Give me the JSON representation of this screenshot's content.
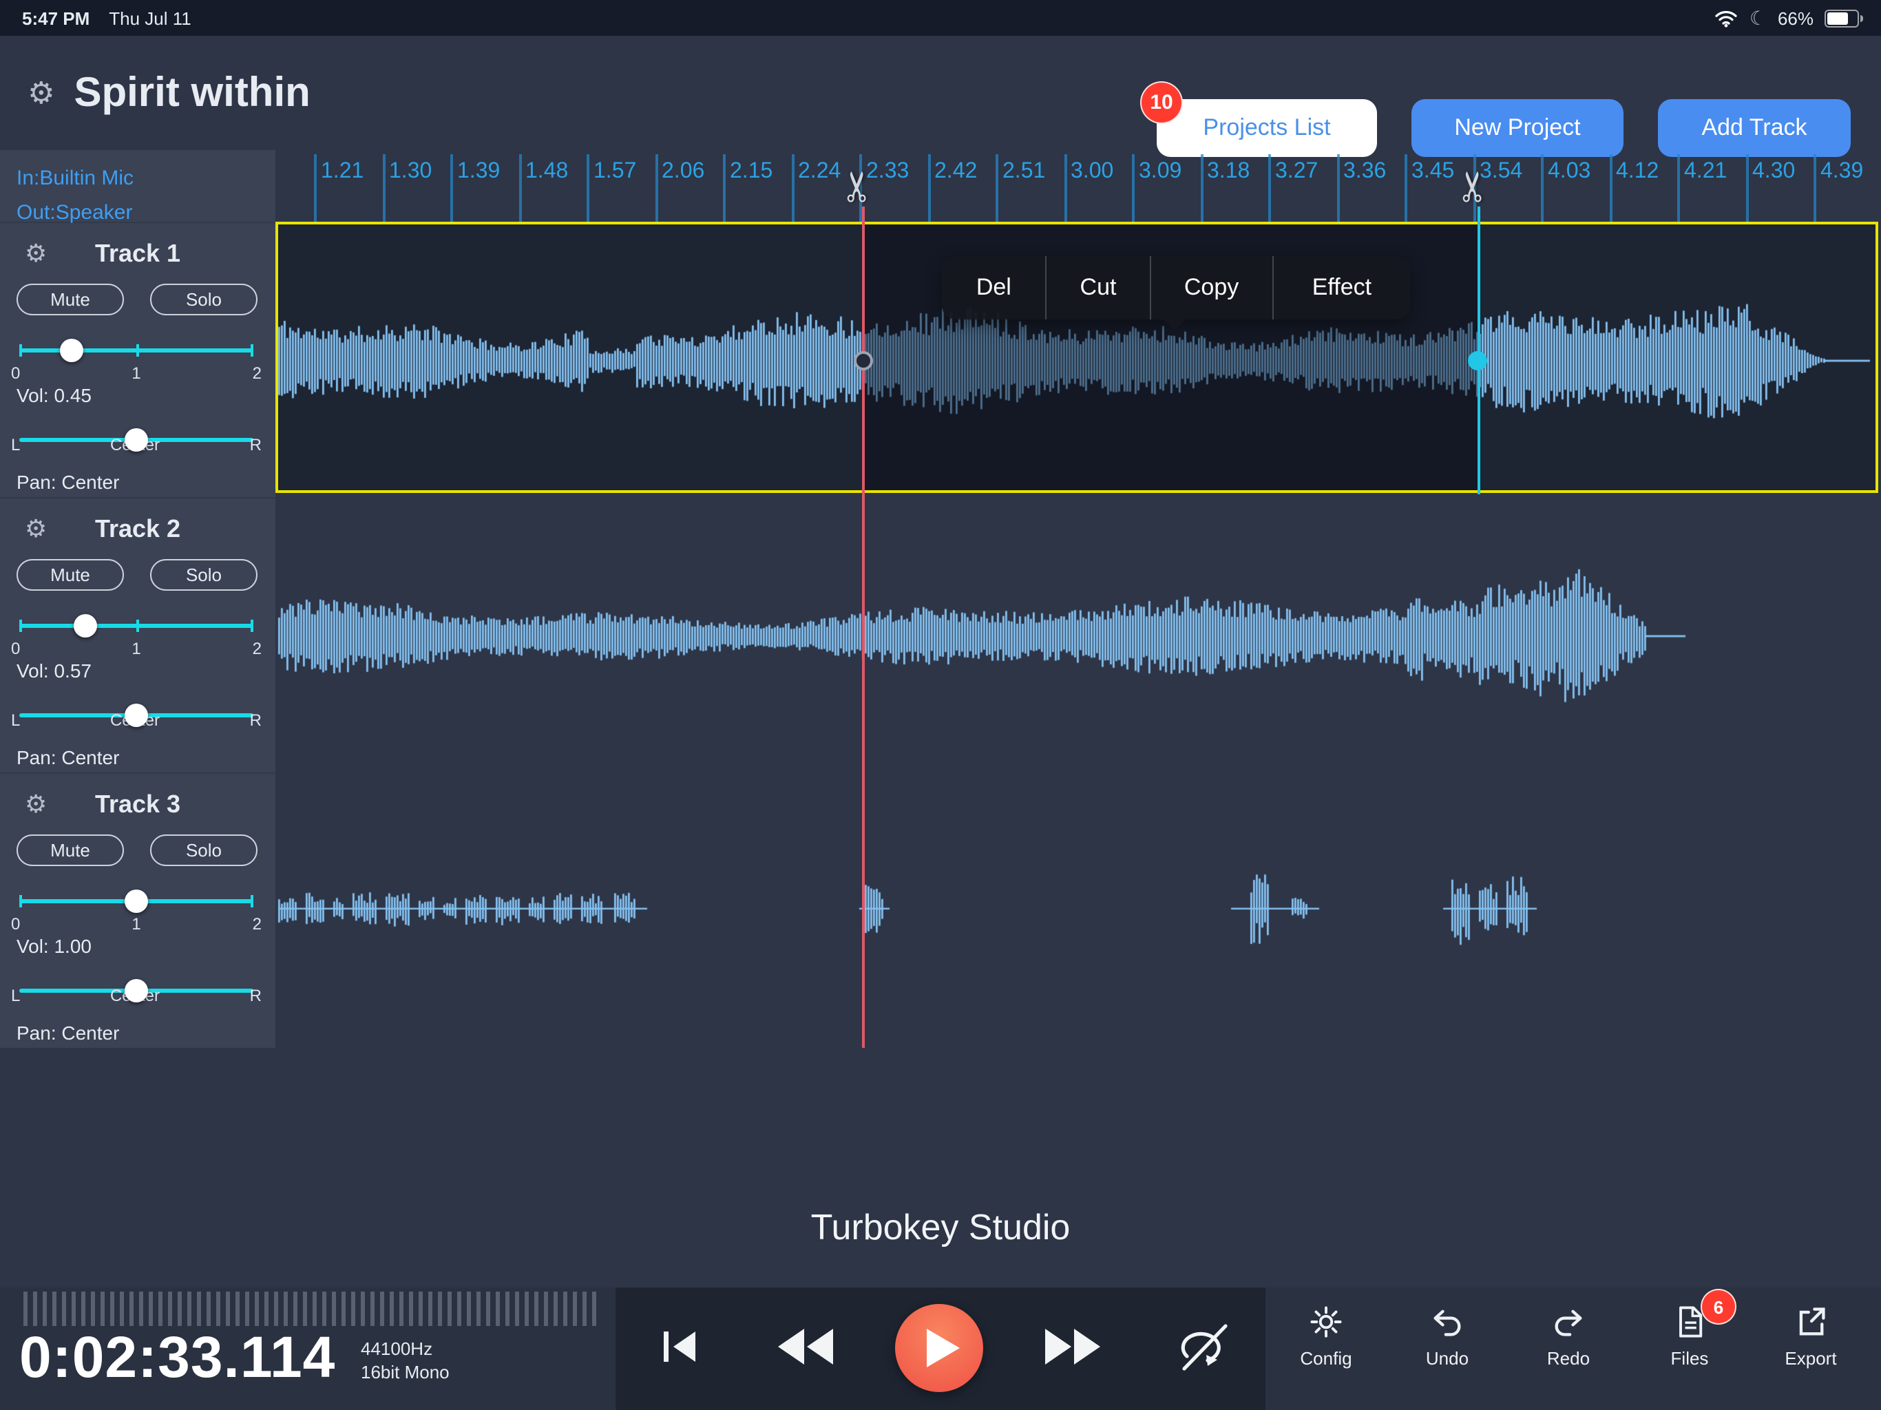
{
  "status_bar": {
    "time": "5:47 PM",
    "date": "Thu Jul 11",
    "battery_pct": "66%"
  },
  "header": {
    "title": "Spirit within",
    "projects_list_label": "Projects List",
    "projects_badge": "10",
    "new_project_label": "New Project",
    "add_track_label": "Add Track"
  },
  "io": {
    "input": "In:Builtin Mic",
    "output": "Out:Speaker"
  },
  "slider": {
    "vol_ticks": [
      "0",
      "1",
      "2"
    ],
    "pan_ticks": [
      "L",
      "Center",
      "R"
    ]
  },
  "tracks": [
    {
      "name": "Track 1",
      "mute": "Mute",
      "solo": "Solo",
      "vol": 0.45,
      "vol_label": "Vol: 0.45",
      "pan_label": "Pan: Center"
    },
    {
      "name": "Track 2",
      "mute": "Mute",
      "solo": "Solo",
      "vol": 0.57,
      "vol_label": "Vol: 0.57",
      "pan_label": "Pan: Center"
    },
    {
      "name": "Track 3",
      "mute": "Mute",
      "solo": "Solo",
      "vol": 1.0,
      "vol_label": "Vol: 1.00",
      "pan_label": "Pan: Center"
    }
  ],
  "ruler": {
    "ticks": [
      "1.21",
      "1.30",
      "1.39",
      "1.48",
      "1.57",
      "2.06",
      "2.15",
      "2.24",
      "2.33",
      "2.42",
      "2.51",
      "3.00",
      "3.09",
      "3.18",
      "3.27",
      "3.36",
      "3.45",
      "3.54",
      "4.03",
      "4.12",
      "4.21",
      "4.30",
      "4.39"
    ]
  },
  "context_menu": {
    "items": [
      "Del",
      "Cut",
      "Copy",
      "Effect"
    ]
  },
  "studio_label": "Turbokey Studio",
  "transport": {
    "time": "0:02:33.114",
    "sample_rate": "44100Hz",
    "format": "16bit Mono"
  },
  "toolbar": {
    "items": [
      {
        "label": "Config",
        "icon": "gear-icon"
      },
      {
        "label": "Undo",
        "icon": "undo-icon"
      },
      {
        "label": "Redo",
        "icon": "redo-icon"
      },
      {
        "label": "Files",
        "icon": "files-icon",
        "badge": "6"
      },
      {
        "label": "Export",
        "icon": "export-icon"
      }
    ]
  },
  "colors": {
    "accent_blue": "#4a90e8",
    "slider_cyan": "#19dbe8",
    "waveform": "#85c2f2",
    "selection_border": "#e8e400",
    "play_button": "#f4694e",
    "badge_red": "#ff3b30"
  }
}
